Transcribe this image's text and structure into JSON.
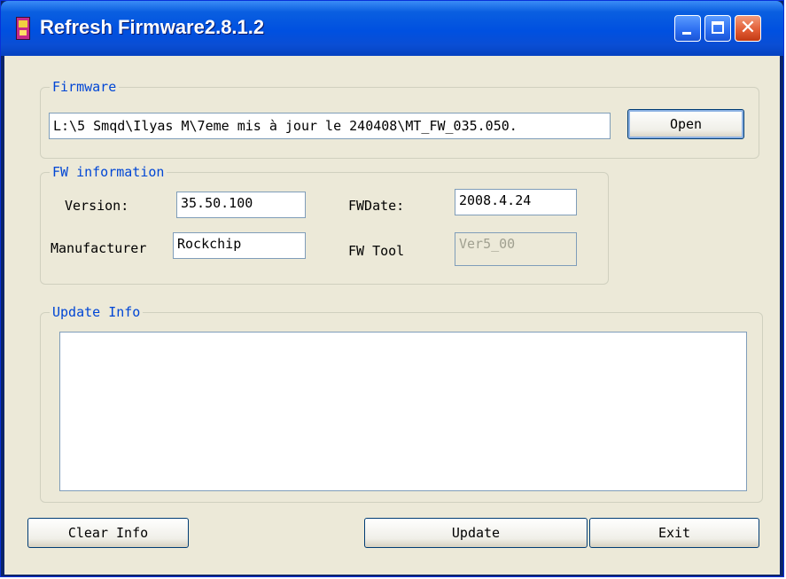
{
  "window": {
    "title": "Refresh Firmware2.8.1.2"
  },
  "firmware": {
    "legend": "Firmware",
    "path": "L:\\5 Smqd\\Ilyas M\\7eme mis à jour le 240408\\MT_FW_035.050.",
    "open_label": "Open"
  },
  "fw_info": {
    "legend": "FW information",
    "version_label": "Version:",
    "version_value": "35.50.100",
    "fwdate_label": "FWDate:",
    "fwdate_value": "2008.4.24",
    "manufacturer_label": "Manufacturer",
    "manufacturer_value": "Rockchip",
    "fwtool_label": "FW Tool",
    "fwtool_value": "Ver5_00"
  },
  "update_info": {
    "legend": "Update Info",
    "text": ""
  },
  "buttons": {
    "clear_info": "Clear Info",
    "update": "Update",
    "exit": "Exit"
  }
}
